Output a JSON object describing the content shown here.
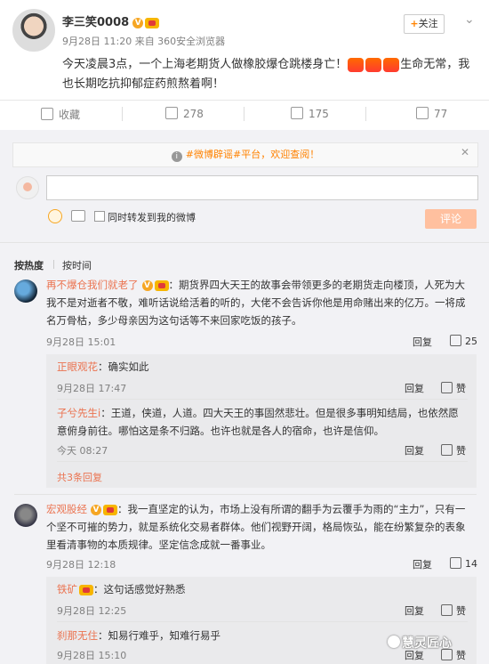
{
  "post": {
    "author": "李三笑0008",
    "meta": "9月28日 11:20 来自 360安全浏览器",
    "follow_label": "关注",
    "text_1": "今天凌晨3点，一个上海老期货人做橡胶爆仓跳楼身亡！",
    "text_2": "生命无常，我也长期吃抗抑郁症药煎熬着啊！"
  },
  "actions": {
    "collect": "收藏",
    "forward": "278",
    "comment": "175",
    "like": "77"
  },
  "notice": {
    "text": "#微博辟谣#平台，欢迎查阅！"
  },
  "composer": {
    "checkbox_label": "同时转发到我的微博",
    "submit_label": "评论"
  },
  "sort": {
    "hot": "按热度",
    "time": "按时间"
  },
  "comments": [
    {
      "user": "再不爆仓我们就老了",
      "text": "：期货界四大天王的故事会带领更多的老期货走向楼顶，人死为大我不是对逝者不敬，难听话说给活着的听的，大佬不会告诉你他是用命赌出来的亿万。一将成名万骨枯，多少母亲因为这句话等不来回家吃饭的孩子。",
      "time": "9月28日 15:01",
      "reply": "回复",
      "likes": "25",
      "replies": [
        {
          "user": "正眼观花",
          "text": "：确实如此",
          "time": "9月28日 17:47",
          "reply": "回复",
          "likes": "赞"
        },
        {
          "user": "子兮先生i",
          "text": "：王道，侠道，人道。四大天王的事固然悲壮。但是很多事明知结局，也依然愿意俯身前往。哪怕这是条不归路。也许也就是各人的宿命，也许是信仰。",
          "time": "今天 08:27",
          "reply": "回复",
          "likes": "赞"
        }
      ],
      "more": "共3条回复"
    },
    {
      "user": "宏观股经",
      "text": "：我一直坚定的认为，市场上没有所谓的翻手为云覆手为雨的“主力”，只有一个坚不可摧的势力，就是系统化交易者群体。他们视野开阔，格局恢弘，能在纷繁复杂的表象里看清事物的本质规律。坚定信念成就一番事业。",
      "time": "9月28日 12:18",
      "reply": "回复",
      "likes": "14",
      "replies": [
        {
          "user": "铁矿",
          "text": "：这句话感觉好熟悉",
          "time": "9月28日 12:25",
          "reply": "回复",
          "likes": "赞"
        },
        {
          "user": "刹那无住",
          "text": "：知易行难乎，知难行易乎",
          "time": "9月28日 15:10",
          "reply": "回复",
          "likes": "赞"
        }
      ]
    }
  ],
  "watermark": "慧灵匠心"
}
